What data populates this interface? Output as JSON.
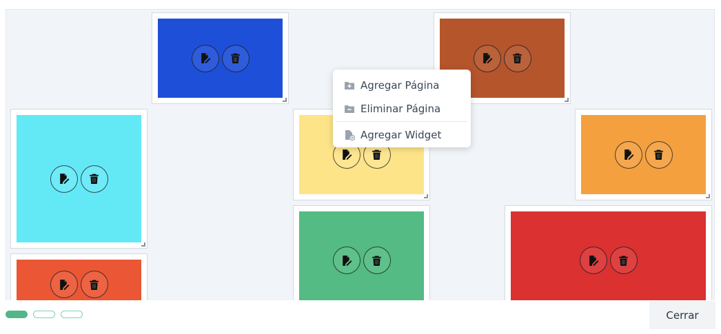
{
  "context_menu": {
    "items": [
      {
        "label": "Agregar Página",
        "icon": "folder-plus-icon"
      },
      {
        "label": "Eliminar Página",
        "icon": "folder-minus-icon"
      },
      {
        "label": "Agregar Widget",
        "icon": "file-add-icon"
      }
    ]
  },
  "widgets": [
    {
      "color": "#1e4fd8"
    },
    {
      "color": "#b5552b"
    },
    {
      "color": "#63e9f6"
    },
    {
      "color": "#fde488"
    },
    {
      "color": "#f4a03f"
    },
    {
      "color": "#53bb83"
    },
    {
      "color": "#db3131"
    },
    {
      "color": "#eb5735"
    }
  ],
  "widget_actions": {
    "edit_icon": "edit-icon",
    "delete_icon": "trash-icon"
  },
  "pager": {
    "pages": 3,
    "active_index": 0
  },
  "footer": {
    "close_label": "Cerrar"
  },
  "colors": {
    "accent": "#52b788",
    "menu_text": "#3a4756",
    "canvas_bg": "#f1f4f8"
  }
}
